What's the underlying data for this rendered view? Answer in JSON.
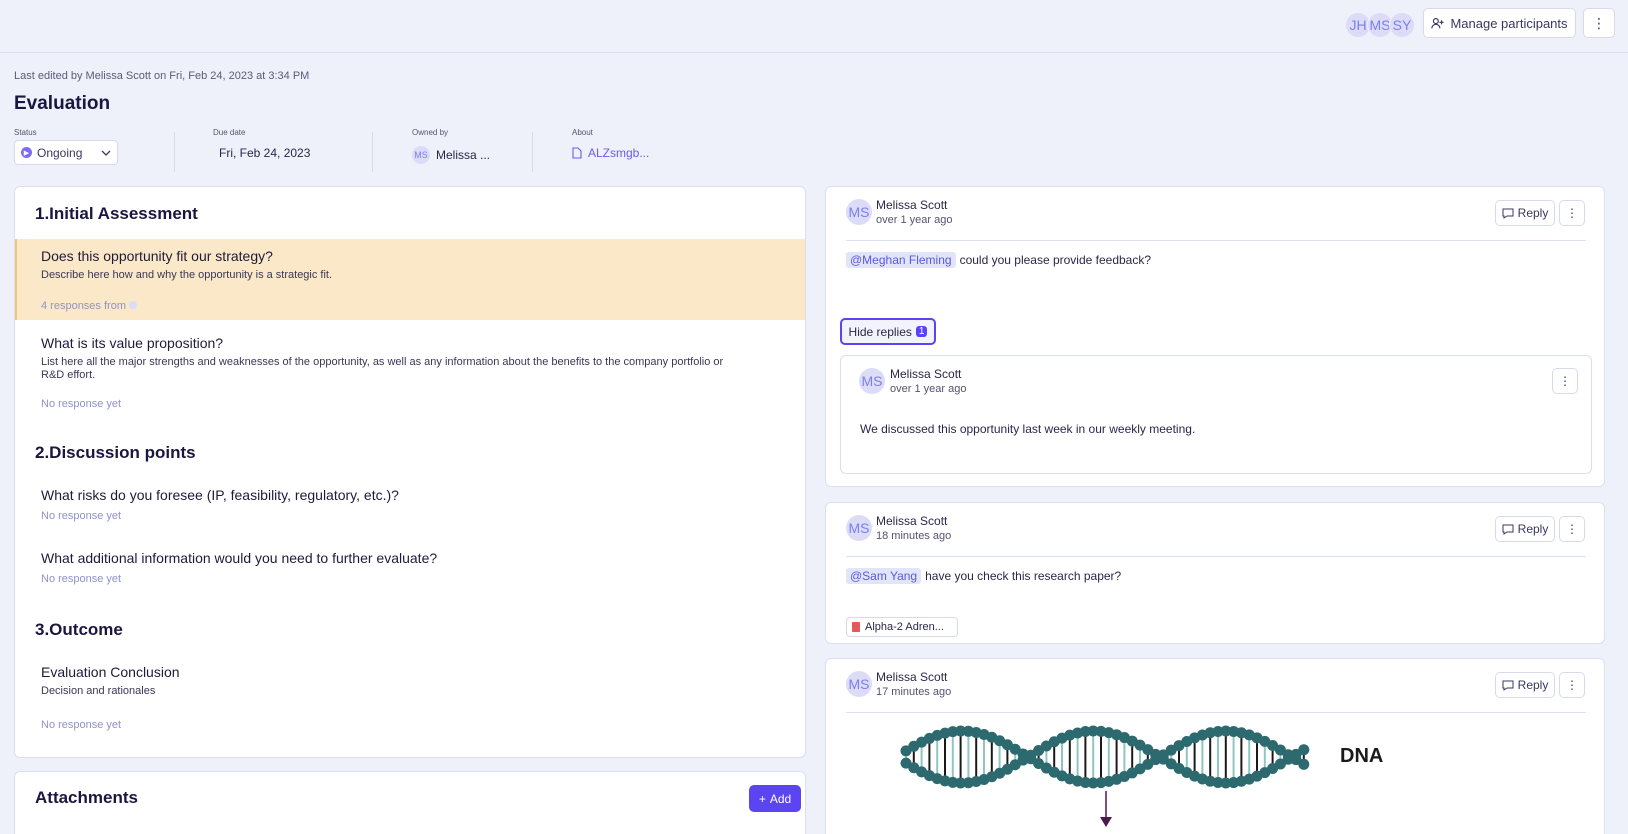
{
  "header": {
    "avatars": [
      "JH",
      "MS",
      "SY"
    ],
    "manage_label": "Manage participants",
    "more_label": "⋮"
  },
  "doc": {
    "edited": "Last edited by Melissa Scott on Fri, Feb 24, 2023 at 3:34 PM",
    "title": "Evaluation",
    "status_label": "Status",
    "status_value": "Ongoing",
    "due_label": "Due date",
    "due_value": "Fri, Feb 24, 2023",
    "owner_label": "Owned by",
    "owner_initials": "MS",
    "owner_value": "Melissa ...",
    "about_label": "About",
    "about_value": "ALZsmgb..."
  },
  "sections": {
    "s1": "1.Initial Assessment",
    "s2": "2.Discussion points",
    "s3": "3.Outcome"
  },
  "questions": [
    {
      "title": "Does this opportunity fit our strategy?",
      "desc": "Describe here how and why the opportunity is a strategic fit.",
      "resp": "4 responses from"
    },
    {
      "title": "What is its value proposition?",
      "desc": "List here all the major strengths and weaknesses of the opportunity, as well as any information about the benefits to the company portfolio or R&D effort.",
      "resp": "No response yet"
    },
    {
      "title": "What risks do you foresee (IP, feasibility, regulatory, etc.)?",
      "resp": "No response yet"
    },
    {
      "title": "What additional information would you need to further evaluate?",
      "resp": "No response yet"
    },
    {
      "title": "Evaluation Conclusion",
      "desc": "Decision and rationales",
      "resp": "No response yet"
    }
  ],
  "attachments": {
    "title": "Attachments",
    "add_label": "Add"
  },
  "comments": [
    {
      "initials": "MS",
      "name": "Melissa Scott",
      "time": "over 1 year ago",
      "mention": "@Meghan Fleming",
      "text": "could you please provide feedback?",
      "reply_label": "Reply",
      "hide_label": "Hide replies",
      "reply_count": "1",
      "nested": {
        "initials": "MS",
        "name": "Melissa Scott",
        "time": "over 1 year ago",
        "text": "We discussed this opportunity last week in our weekly meeting."
      }
    },
    {
      "initials": "MS",
      "name": "Melissa Scott",
      "time": "18 minutes ago",
      "mention": "@Sam Yang",
      "text": "have you check this research paper?",
      "reply_label": "Reply",
      "file": "Alpha-2 Adren..."
    },
    {
      "initials": "MS",
      "name": "Melissa Scott",
      "time": "17 minutes ago",
      "reply_label": "Reply",
      "image_label": "DNA"
    }
  ],
  "colors": {
    "accent": "#5b45f2",
    "highlight": "#fbe8c8",
    "background": "#eef1fa"
  }
}
